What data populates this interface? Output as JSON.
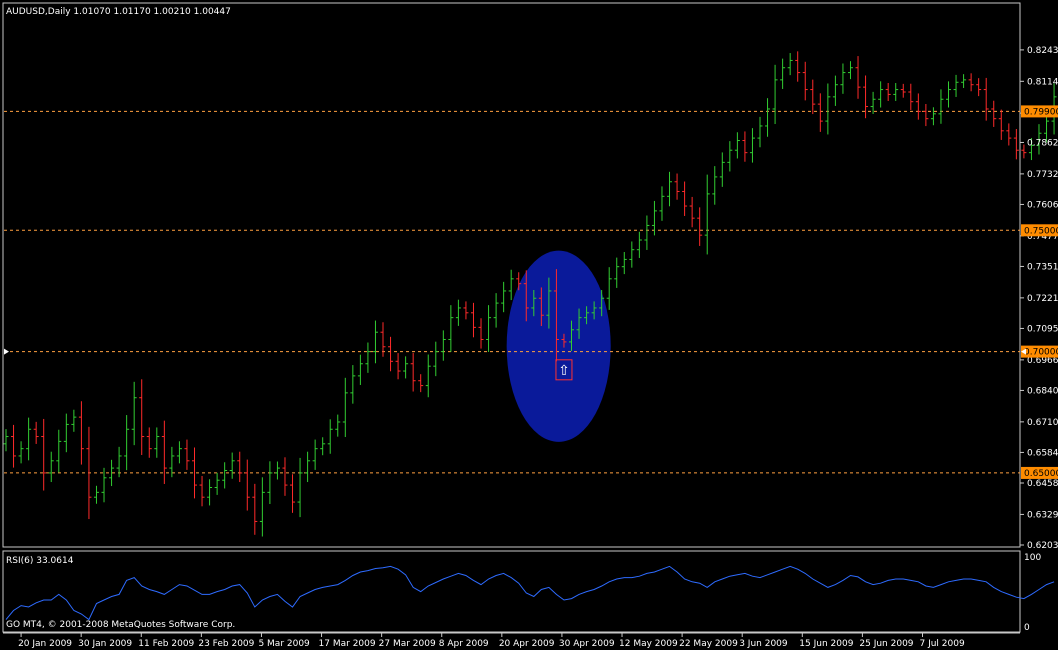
{
  "main_panel": {
    "header": "AUDUSD,Daily  1.01070 1.01170 1.00210 1.00447"
  },
  "rsi_panel": {
    "header": "RSI(6) 33.0614",
    "levels": [
      "100",
      "0"
    ]
  },
  "copyright": "GO MT4, © 2001-2008 MetaQuotes Software Corp.",
  "colors": {
    "background": "#000000",
    "up_bar": "#32CD32",
    "down_bar": "#FF2A2A",
    "level_line": "#FFA040",
    "level_badge": "#FF8C00",
    "ellipse": "#0A1A9A",
    "rsi_line": "#2E6BFF",
    "arrow_marker": "#FF3030"
  },
  "chart_data": {
    "type": "ohlc",
    "symbol": "AUDUSD",
    "timeframe": "Daily",
    "y_ticks": [
      "0.82435",
      "0.81140",
      "0.79830",
      "0.78620",
      "0.77325",
      "0.76065",
      "0.74770",
      "0.73510",
      "0.72215",
      "0.70955",
      "0.69660",
      "0.68400",
      "0.67105",
      "0.65845",
      "0.64585",
      "0.63290",
      "0.62030"
    ],
    "ylim": [
      0.6203,
      0.8309
    ],
    "x_labels": [
      "20 Jan 2009",
      "30 Jan 2009",
      "11 Feb 2009",
      "23 Feb 2009",
      "5 Mar 2009",
      "17 Mar 2009",
      "27 Mar 2009",
      "8 Apr 2009",
      "20 Apr 2009",
      "30 Apr 2009",
      "12 May 2009",
      "22 May 2009",
      "3 Jun 2009",
      "15 Jun 2009",
      "25 Jun 2009",
      "7 Jul 2009"
    ],
    "horizontal_levels": [
      {
        "value": 0.799,
        "label": "0.79900"
      },
      {
        "value": 0.75,
        "label": "0.75000"
      },
      {
        "value": 0.7,
        "label": "0.70000"
      },
      {
        "value": 0.65,
        "label": "0.65000"
      }
    ],
    "closes": [
      0.665,
      0.657,
      0.66,
      0.668,
      0.665,
      0.65,
      0.655,
      0.663,
      0.67,
      0.673,
      0.66,
      0.64,
      0.642,
      0.648,
      0.652,
      0.657,
      0.668,
      0.681,
      0.665,
      0.66,
      0.665,
      0.652,
      0.657,
      0.66,
      0.655,
      0.645,
      0.64,
      0.644,
      0.647,
      0.651,
      0.655,
      0.65,
      0.64,
      0.63,
      0.642,
      0.65,
      0.652,
      0.645,
      0.638,
      0.65,
      0.655,
      0.66,
      0.662,
      0.668,
      0.671,
      0.683,
      0.69,
      0.695,
      0.7,
      0.708,
      0.702,
      0.696,
      0.692,
      0.695,
      0.688,
      0.686,
      0.694,
      0.7,
      0.705,
      0.714,
      0.718,
      0.716,
      0.71,
      0.705,
      0.714,
      0.72,
      0.725,
      0.73,
      0.728,
      0.718,
      0.722,
      0.715,
      0.725,
      0.705,
      0.704,
      0.709,
      0.714,
      0.716,
      0.718,
      0.722,
      0.73,
      0.735,
      0.738,
      0.742,
      0.746,
      0.752,
      0.758,
      0.764,
      0.77,
      0.766,
      0.76,
      0.755,
      0.748,
      0.765,
      0.772,
      0.778,
      0.783,
      0.787,
      0.782,
      0.788,
      0.793,
      0.8,
      0.812,
      0.817,
      0.82,
      0.815,
      0.808,
      0.802,
      0.795,
      0.805,
      0.81,
      0.815,
      0.817,
      0.809,
      0.801,
      0.804,
      0.808,
      0.806,
      0.808,
      0.807,
      0.803,
      0.799,
      0.796,
      0.798,
      0.804,
      0.808,
      0.811,
      0.812,
      0.81,
      0.808,
      0.8,
      0.796,
      0.791,
      0.788,
      0.783,
      0.782,
      0.785,
      0.79,
      0.795,
      0.805
    ],
    "first_label_bar": 2,
    "label_bar_spacing": 7.97,
    "highlight": {
      "shape": "ellipse",
      "center_bar": 73.3,
      "center_value": 0.7022,
      "bar_radius": 6.9,
      "value_radius": 0.0394
    },
    "arrow_marker": {
      "bar": 74,
      "value": 0.6925,
      "glyph": "⇧"
    },
    "rsi": {
      "period": 6,
      "current": 33.0614,
      "ylim": [
        0,
        100
      ],
      "values": [
        12,
        25,
        32,
        30,
        36,
        40,
        40,
        48,
        40,
        25,
        20,
        12,
        35,
        40,
        45,
        48,
        68,
        72,
        60,
        55,
        52,
        48,
        55,
        62,
        60,
        54,
        48,
        48,
        52,
        55,
        60,
        62,
        50,
        30,
        40,
        45,
        48,
        38,
        30,
        45,
        50,
        55,
        58,
        60,
        62,
        68,
        75,
        80,
        82,
        85,
        86,
        88,
        84,
        76,
        58,
        52,
        60,
        65,
        70,
        74,
        78,
        75,
        68,
        62,
        70,
        75,
        78,
        72,
        64,
        50,
        45,
        55,
        58,
        48,
        40,
        42,
        48,
        52,
        55,
        60,
        66,
        70,
        72,
        72,
        74,
        78,
        80,
        84,
        88,
        80,
        70,
        66,
        64,
        58,
        66,
        70,
        74,
        76,
        78,
        74,
        72,
        76,
        80,
        84,
        88,
        84,
        78,
        70,
        64,
        58,
        62,
        68,
        75,
        73,
        66,
        62,
        64,
        68,
        70,
        70,
        68,
        66,
        60,
        58,
        62,
        66,
        68,
        70,
        70,
        68,
        66,
        58,
        52,
        48,
        44,
        42,
        48,
        55,
        62,
        66
      ]
    }
  }
}
